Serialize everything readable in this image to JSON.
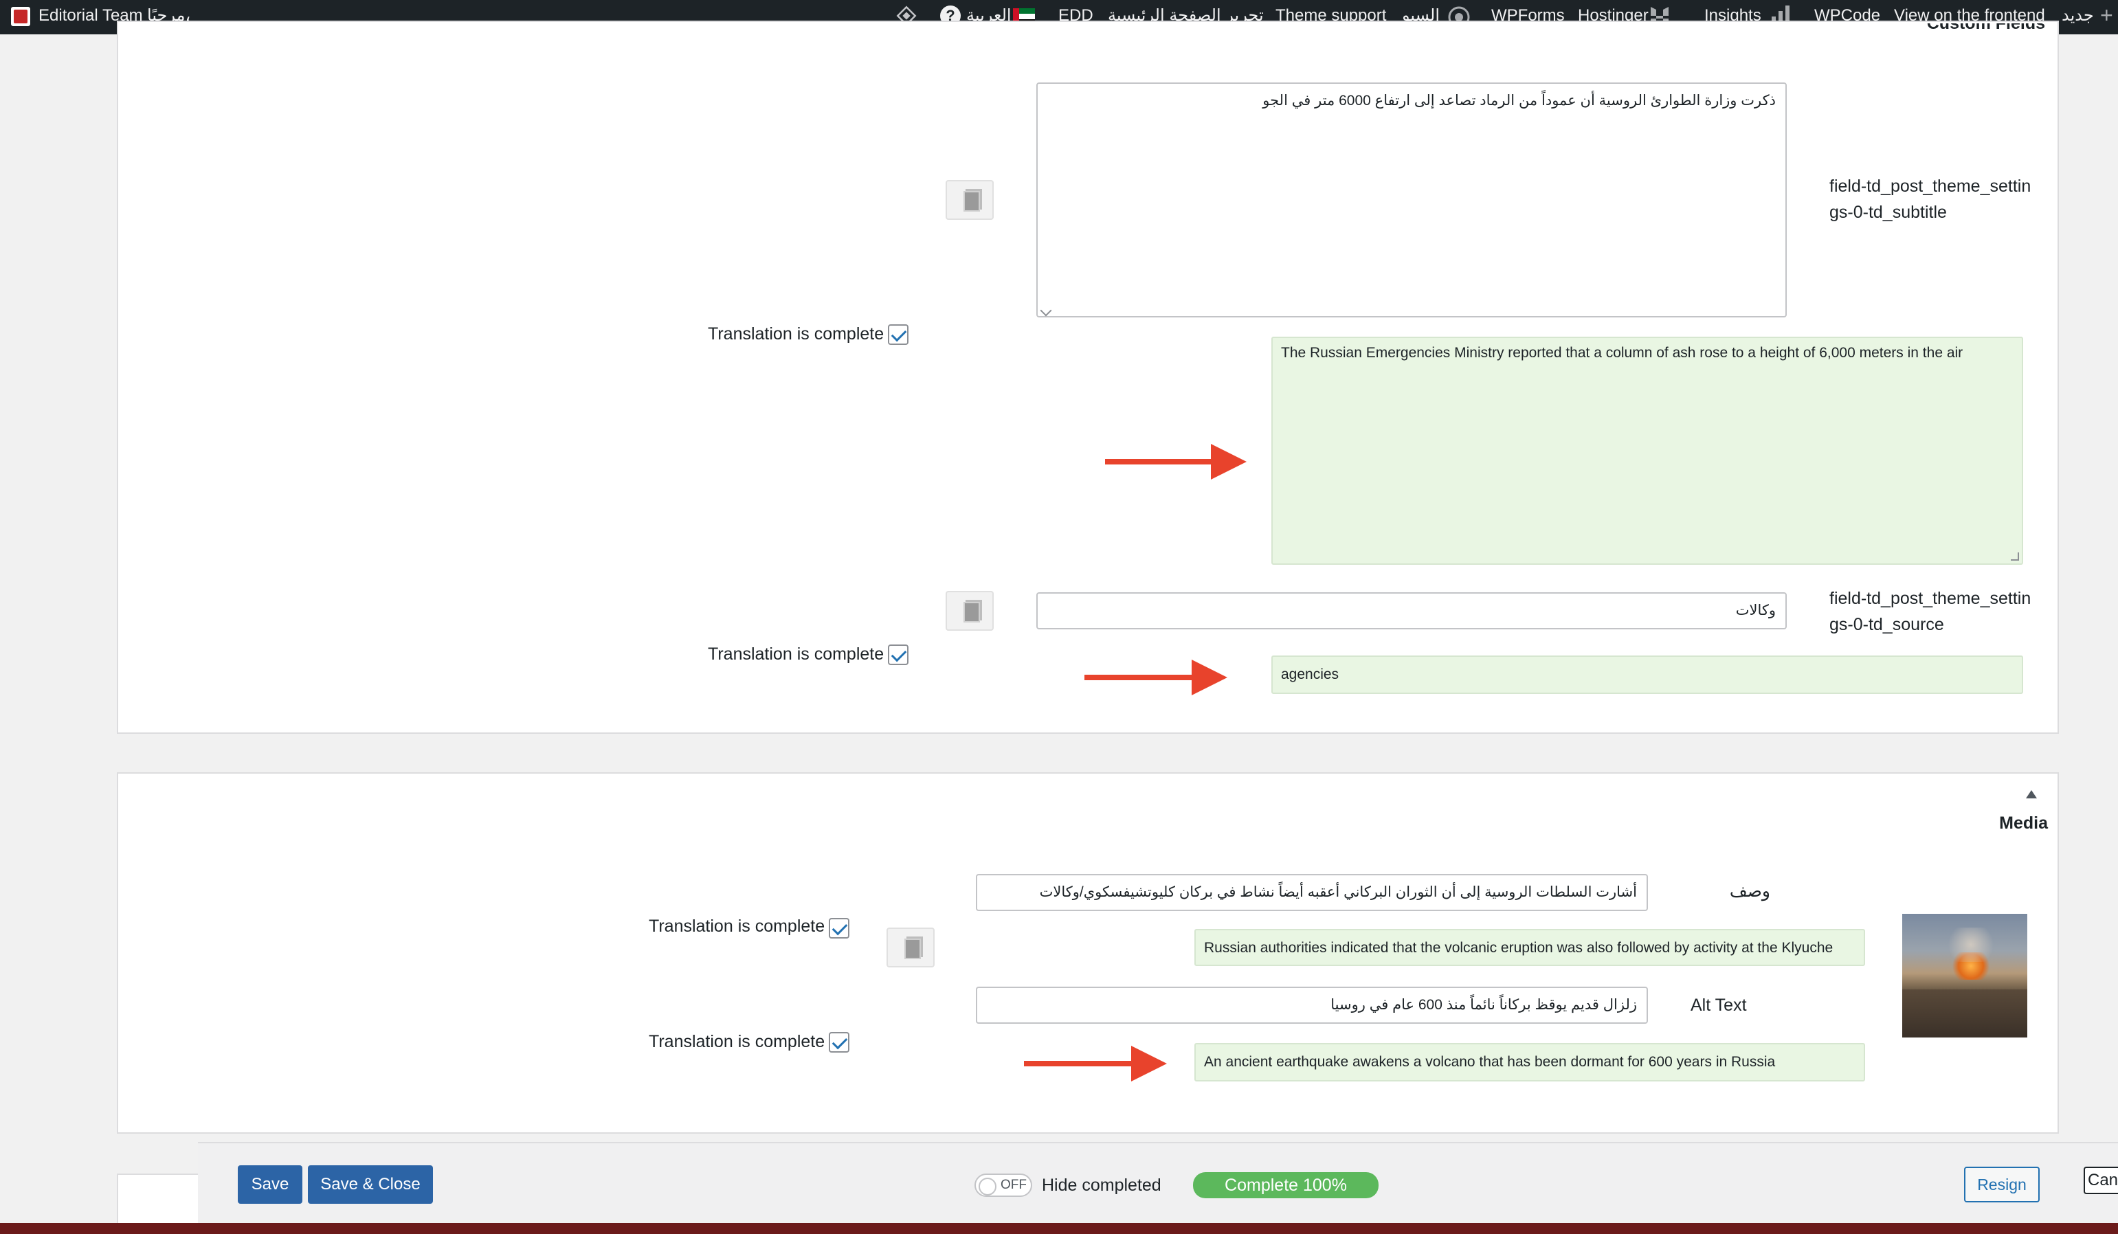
{
  "adminbar": {
    "site_name": "Editorial Team",
    "greeting": "مرحبًا،",
    "language": "العربية",
    "edd": "EDD",
    "edit_homepage": "تحرير الصفحة الرئيسية",
    "theme_support": "Theme support",
    "seo": "السيو",
    "wpforms": "WPForms",
    "hostinger": "Hostinger",
    "insights": "Insights",
    "wpcode": "WPCode",
    "view_frontend": "View on the frontend",
    "new": "جديد",
    "colors": {
      "bar_bg": "#1d2327",
      "text": "#f0f0f1"
    }
  },
  "custom_fields": {
    "title": "Custom Fields",
    "subtitle_field": {
      "label": "field-td_post_theme_settings-0-td_subtitle",
      "original": "ذكرت وزارة الطوارئ الروسية أن عموداً من الرماد تصاعد إلى ارتفاع 6000 متر في الجو",
      "translation": "The Russian Emergencies Ministry reported that a column of ash rose to a height of 6,000 meters in the air",
      "complete_label": "Translation is complete"
    },
    "source_field": {
      "label": "field-td_post_theme_settings-0-td_source",
      "original": "وكالات",
      "translation": "agencies",
      "complete_label": "Translation is complete"
    }
  },
  "media": {
    "title": "Media",
    "description": {
      "label": "وصف",
      "original": "أشارت السلطات الروسية إلى أن الثوران البركاني أعقبه أيضاً نشاط في بركان كليوتشيفسكوي/وكالات",
      "translation": "Russian authorities indicated that the volcanic eruption was also followed by activity at the Klyuche",
      "complete_label": "Translation is complete"
    },
    "alt_text": {
      "label": "Alt Text",
      "original": "زلزال قديم يوقظ بركاناً نائماً منذ 600 عام في روسيا",
      "translation": "An ancient earthquake awakens a volcano that has been dormant for 600 years in Russia",
      "complete_label": "Translation is complete"
    }
  },
  "footer": {
    "save": "Save",
    "save_close": "Save & Close",
    "toggle_state": "OFF",
    "hide_completed": "Hide completed",
    "progress": "Complete 100%",
    "resign": "Resign",
    "cancel": "Canc"
  },
  "colors": {
    "arrow": "#e8432c",
    "translation_bg": "#e9f6e3",
    "primary_button": "#2c64a6",
    "progress_pill": "#5cb85c"
  }
}
